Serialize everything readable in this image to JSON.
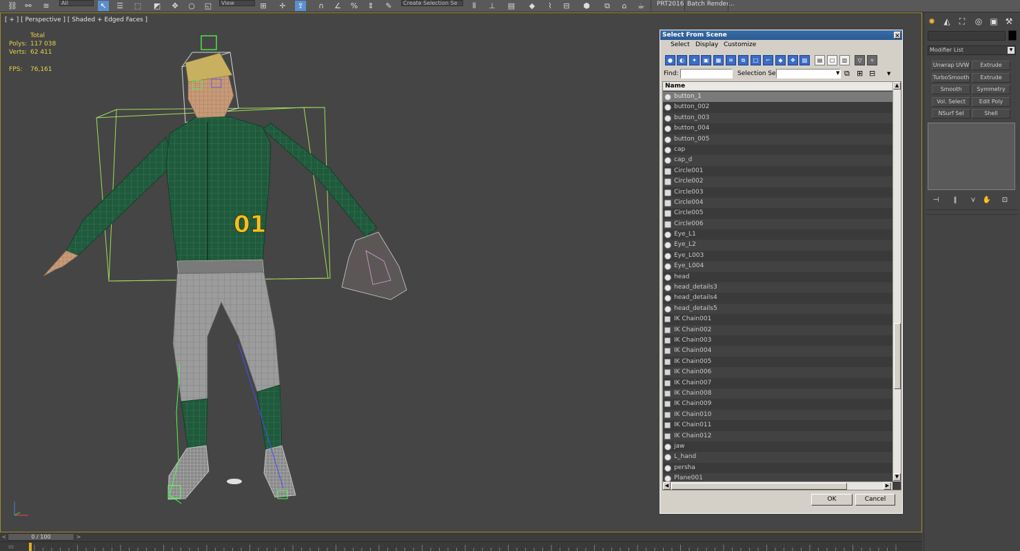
{
  "toolbar": {
    "filter_value": "All",
    "view_value": "View",
    "selection_set_placeholder": "Create Selection Se",
    "prt_label": "PRT2016",
    "batch_render_label": "Batch Render..."
  },
  "viewport": {
    "label": "[ + ] [ Perspective ] [ Shaded + Edged Faces ]",
    "stats": {
      "total_header": "Total",
      "polys_label": "Polys:",
      "polys_value": "117 038",
      "verts_label": "Verts:",
      "verts_value": "62 411",
      "fps_label": "FPS:",
      "fps_value": "76,161"
    },
    "jersey_number": "01"
  },
  "dialog": {
    "title": "Select From Scene",
    "close_glyph": "×",
    "menu": [
      "Select",
      "Display",
      "Customize"
    ],
    "find_label": "Find:",
    "find_value": "",
    "selection_set_label": "Selection Set:",
    "selection_set_value": "",
    "column_header": "Name",
    "ok_label": "OK",
    "cancel_label": "Cancel",
    "items": [
      {
        "name": "button_1",
        "icon": "geometry-icon",
        "selected": true
      },
      {
        "name": "button_002",
        "icon": "geometry-icon"
      },
      {
        "name": "button_003",
        "icon": "geometry-icon"
      },
      {
        "name": "button_004",
        "icon": "geometry-icon"
      },
      {
        "name": "button_005",
        "icon": "geometry-icon"
      },
      {
        "name": "cap",
        "icon": "geometry-icon"
      },
      {
        "name": "cap_d",
        "icon": "geometry-icon"
      },
      {
        "name": "Circle001",
        "icon": "spline-icon"
      },
      {
        "name": "Circle002",
        "icon": "spline-icon"
      },
      {
        "name": "Circle003",
        "icon": "spline-icon"
      },
      {
        "name": "Circle004",
        "icon": "spline-icon"
      },
      {
        "name": "Circle005",
        "icon": "spline-icon"
      },
      {
        "name": "Circle006",
        "icon": "spline-icon"
      },
      {
        "name": "Eye_L1",
        "icon": "geometry-icon"
      },
      {
        "name": "Eye_L2",
        "icon": "geometry-icon"
      },
      {
        "name": "Eye_L003",
        "icon": "geometry-icon"
      },
      {
        "name": "Eye_L004",
        "icon": "geometry-icon"
      },
      {
        "name": "head",
        "icon": "geometry-icon"
      },
      {
        "name": "head_details3",
        "icon": "geometry-icon"
      },
      {
        "name": "head_details4",
        "icon": "geometry-icon"
      },
      {
        "name": "head_details5",
        "icon": "geometry-icon"
      },
      {
        "name": "IK Chain001",
        "icon": "ik-chain-icon"
      },
      {
        "name": "IK Chain002",
        "icon": "ik-chain-icon"
      },
      {
        "name": "IK Chain003",
        "icon": "ik-chain-icon"
      },
      {
        "name": "IK Chain004",
        "icon": "ik-chain-icon"
      },
      {
        "name": "IK Chain005",
        "icon": "ik-chain-icon"
      },
      {
        "name": "IK Chain006",
        "icon": "ik-chain-icon"
      },
      {
        "name": "IK Chain007",
        "icon": "ik-chain-icon"
      },
      {
        "name": "IK Chain008",
        "icon": "ik-chain-icon"
      },
      {
        "name": "IK Chain009",
        "icon": "ik-chain-icon"
      },
      {
        "name": "IK Chain010",
        "icon": "ik-chain-icon"
      },
      {
        "name": "IK Chain011",
        "icon": "ik-chain-icon"
      },
      {
        "name": "IK Chain012",
        "icon": "ik-chain-icon"
      },
      {
        "name": "jaw",
        "icon": "bone-icon"
      },
      {
        "name": "L_hand",
        "icon": "geometry-icon"
      },
      {
        "name": "persha",
        "icon": "geometry-icon"
      },
      {
        "name": "Plane001",
        "icon": "geometry-icon"
      }
    ]
  },
  "command_panel": {
    "modifier_list_label": "Modifier List",
    "modifier_buttons": [
      "Unwrap UVW",
      "Extrude",
      "TurboSmooth",
      "Extrude",
      "Smooth",
      "Symmetry",
      "Vol. Select",
      "Edit Poly",
      "NSurf Sel",
      "Shell"
    ]
  },
  "timeline": {
    "frame_display": "0 / 100",
    "prev_glyph": "<",
    "next_glyph": ">"
  },
  "colors": {
    "viewport_bg": "#454545",
    "jersey_green": "#1f5a3a",
    "pants_grey": "#9a9a9a",
    "wire_green": "#8fd04a",
    "stats_yellow": "#e8d34a",
    "dialog_title_blue": "#3a6ea5"
  }
}
